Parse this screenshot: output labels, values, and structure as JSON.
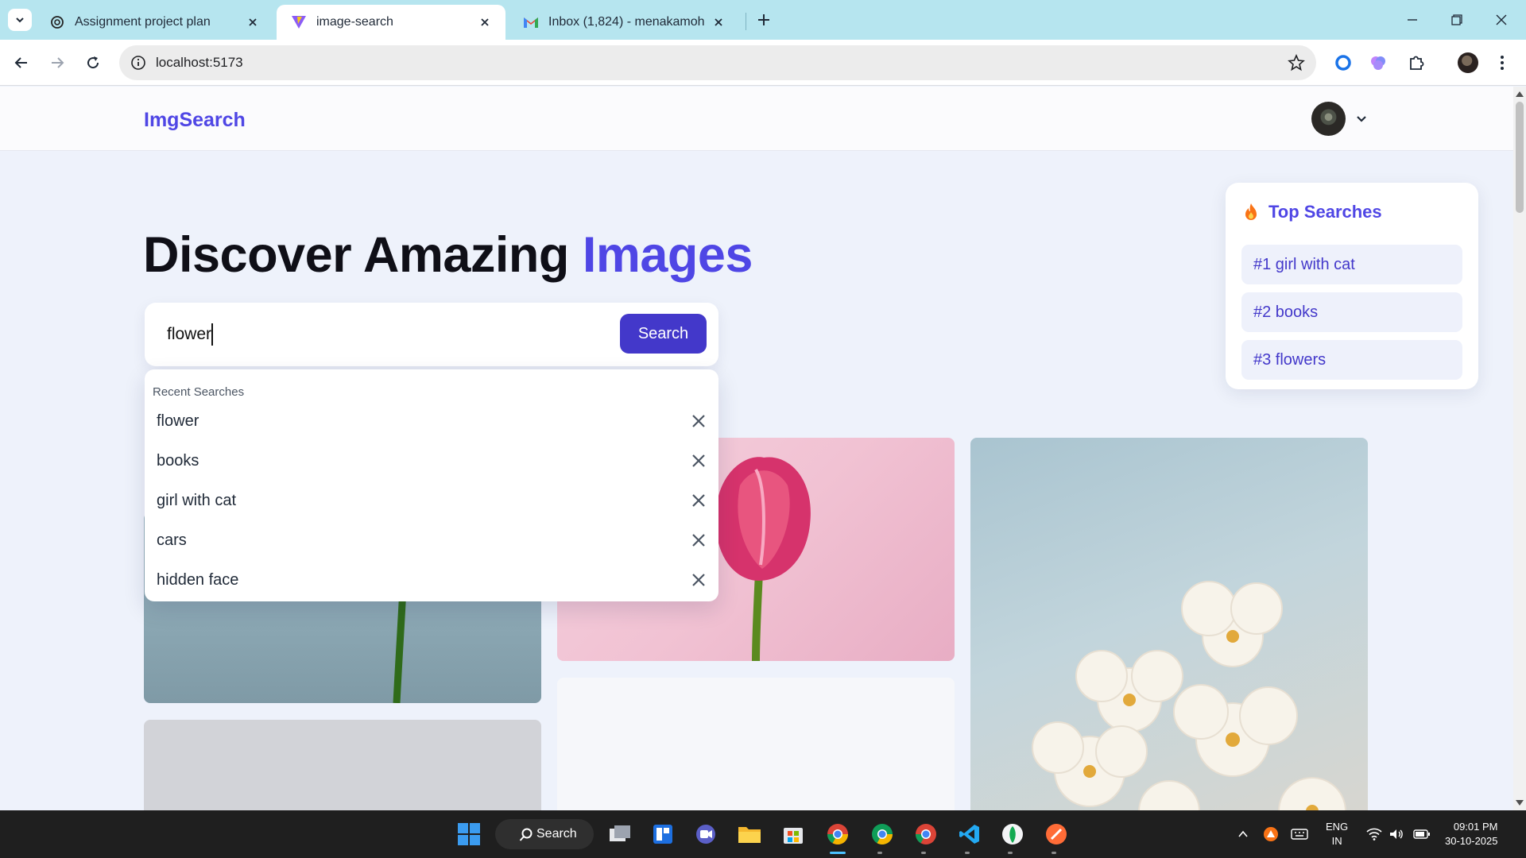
{
  "browser": {
    "tabs": [
      {
        "title": "Assignment project plan",
        "icon": "chatgpt-icon"
      },
      {
        "title": "image-search",
        "icon": "vite-icon"
      },
      {
        "title": "Inbox (1,824) - menakamohan2",
        "icon": "gmail-icon"
      }
    ],
    "active_tab": 1,
    "url": "localhost:5173"
  },
  "site": {
    "logo": "ImgSearch",
    "hero_title_main": "Discover Amazing ",
    "hero_title_accent": "Images",
    "accent_color": "#4f46e5"
  },
  "search": {
    "value": "flower",
    "button_label": "Search"
  },
  "recent": {
    "heading": "Recent Searches",
    "items": [
      "flower",
      "books",
      "girl with cat",
      "cars",
      "hidden face"
    ]
  },
  "top_searches": {
    "title": "Top Searches",
    "items": [
      "#1 girl with cat",
      "#2 books",
      "#3 flowers"
    ]
  },
  "taskbar": {
    "search_label": "Search",
    "lang_top": "ENG",
    "lang_bottom": "IN",
    "time": "09:01 PM",
    "date": "30-10-2025"
  }
}
